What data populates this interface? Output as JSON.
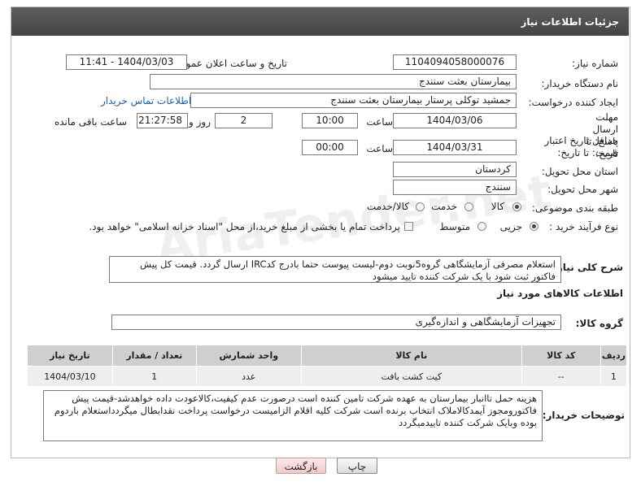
{
  "header": {
    "title": "جزئیات اطلاعات نیاز"
  },
  "fields": {
    "need_number_label": "شماره نیاز:",
    "need_number": "1104094058000076",
    "announce_label": "تاریخ و ساعت اعلان عمومی:",
    "announce_value": "1404/03/03 - 11:41",
    "buyer_org_label": "نام دستگاه خریدار:",
    "buyer_org": "بیمارستان بعثت سنندج",
    "requester_label": "ایجاد کننده درخواست:",
    "requester": "جمشید  توکلی پرستار بیمارستان بعثت سنندج",
    "contact_link": "اطلاعات تماس خریدار",
    "deadline_label": "مهلت ارسال پاسخ: تا تاریخ:",
    "deadline_date": "1404/03/06",
    "time_label": "ساعت",
    "deadline_time": "10:00",
    "days_value": "2",
    "days_label": "روز و",
    "remaining_time": "21:27:58",
    "remaining_label": "ساعت باقی مانده",
    "validity_label": "حداقل تاریخ اعتبار قیمت: تا تاریخ:",
    "validity_date": "1404/03/31",
    "validity_time": "00:00",
    "province_label": "استان محل تحویل:",
    "province": "کردستان",
    "city_label": "شهر محل تحویل:",
    "city": "سنندج",
    "category_label": "طبقه بندی موضوعی:",
    "category_options": [
      "کالا",
      "خدمت",
      "کالا/خدمت"
    ],
    "process_label": "نوع فرآیند خرید :",
    "process_options": [
      "جزیی",
      "متوسط"
    ],
    "payment_note": "پرداخت تمام یا بخشی از مبلغ خرید،از محل \"اسناد خزانه اسلامی\" خواهد بود."
  },
  "description": {
    "label": "شرح کلی نیاز:",
    "text": "استعلام مصرفی آزمایشگاهی گروه5نوبت دوم-لیست پیوست حتما بادرج کدIRC ارسال گردد. قیمت کل پیش فاکتور ثبت شود با یک شرکت کننده تایید میشود"
  },
  "goods_section": {
    "title": "اطلاعات کالاهای مورد نیاز",
    "group_label": "گروه کالا:",
    "group_value": "تجهیزات آزمایشگاهی و اندازه‌گیری"
  },
  "table": {
    "headers": [
      "ردیف",
      "کد کالا",
      "نام کالا",
      "واحد شمارش",
      "تعداد / مقدار",
      "تاریخ نیاز"
    ],
    "rows": [
      [
        "1",
        "--",
        "کیت کشت بافت",
        "عدد",
        "1",
        "1404/03/10"
      ]
    ]
  },
  "buyer_notes": {
    "label": "توضیحات خریدار:",
    "text": "هزینه حمل تاانبار بیمارستان به عهده شرکت تامین کننده است درصورت عدم کیفیت،کالاعودت داده خواهدشد-قیمت پیش فاکتورومجوز آیمدکالاملاک انتخاب برنده است شرکت کلیه اقلام الزامیست درخواست پرداخت نقدابطال میگردداستعلام باردوم بوده وبایک شرکت کننده تاییدمیگردد"
  },
  "buttons": {
    "print": "چاپ",
    "back": "بازگشت"
  },
  "watermark": "AriaTender.net"
}
